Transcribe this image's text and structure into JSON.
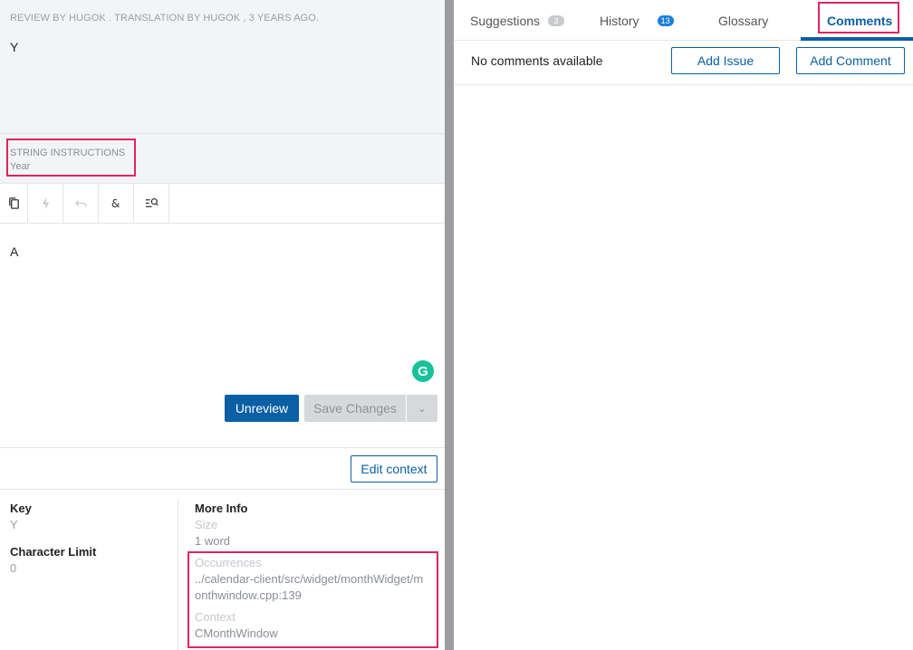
{
  "review": {
    "meta": "REVIEW BY HUGOK . TRANSLATION BY HUGOK , 3 YEARS AGO.",
    "source_text": "Y"
  },
  "instructions": {
    "title": "STRING INSTRUCTIONS",
    "value": "Year"
  },
  "toolbar": {
    "icons": [
      "copy-icon",
      "lightning-icon",
      "undo-icon",
      "special-char-icon",
      "search-text-icon"
    ]
  },
  "editor": {
    "text": "A",
    "grammarly_letter": "G",
    "unreview_label": "Unreview",
    "save_label": "Save Changes"
  },
  "context": {
    "edit_label": "Edit context"
  },
  "info": {
    "key_label": "Key",
    "key_value": "Y",
    "char_limit_label": "Character Limit",
    "char_limit_value": "0",
    "more_info_label": "More Info",
    "size_label": "Size",
    "size_value": "1 word",
    "occurrences_label": "Occurrences",
    "occurrences_line1": "../calendar-client/src/widget/monthWidget/m",
    "occurrences_line2": "onthwindow.cpp:139",
    "context_label": "Context",
    "context_value": "CMonthWindow"
  },
  "tabs": [
    {
      "label": "Suggestions",
      "badge": "3"
    },
    {
      "label": "History",
      "badge": "13"
    },
    {
      "label": "Glossary"
    },
    {
      "label": "Comments"
    }
  ],
  "comments": {
    "empty_text": "No comments available",
    "add_issue_label": "Add Issue",
    "add_comment_label": "Add Comment"
  },
  "colors": {
    "primary": "#0b5fa5",
    "highlight": "#e0245e",
    "grammarly": "#15c39a",
    "badge_blue": "#1e7fd8"
  }
}
